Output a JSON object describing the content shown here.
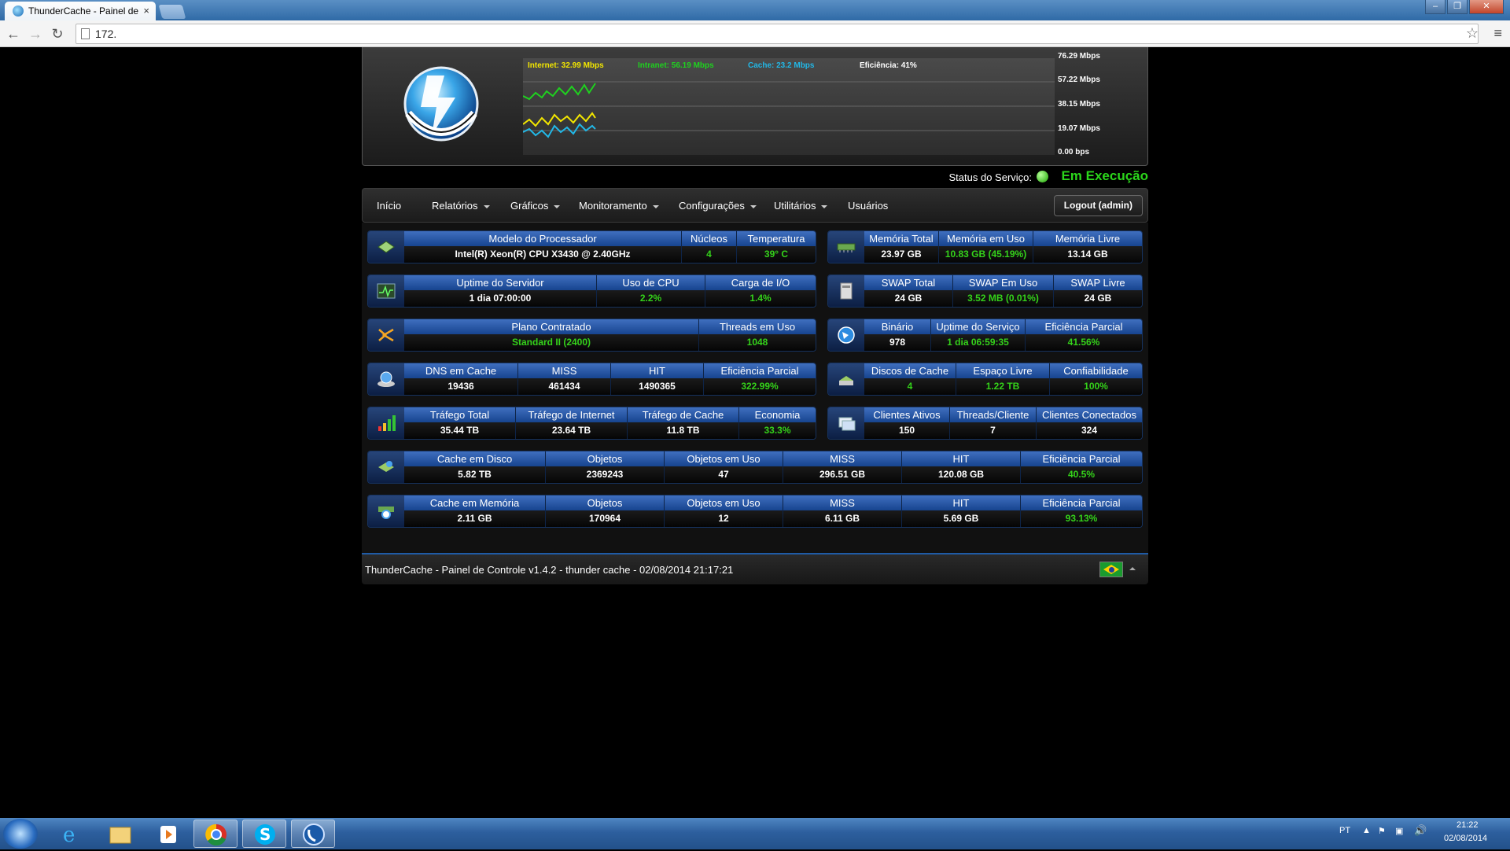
{
  "browser": {
    "tab_title": "ThunderCache - Painel de",
    "tab_close": "×",
    "address": "172."
  },
  "header": {
    "graph": {
      "legend_internet": "Internet: 32.99 Mbps",
      "legend_intranet": "Intranet: 56.19 Mbps",
      "legend_cache": "Cache: 23.2 Mbps",
      "legend_efficiency": "Eficiência: 41%",
      "scale": [
        "76.29 Mbps",
        "57.22 Mbps",
        "38.15 Mbps",
        "19.07 Mbps",
        "0.00 bps"
      ],
      "colors": {
        "internet": "#f2e600",
        "intranet": "#1fd11f",
        "cache": "#22b7e6",
        "efficiency": "#ffffff"
      }
    },
    "status_label": "Status do Serviço:",
    "status_value": "Em Execução"
  },
  "nav": {
    "items": [
      "Início",
      "Relatórios",
      "Gráficos",
      "Monitoramento",
      "Configurações",
      "Utilitários",
      "Usuários"
    ],
    "logout": "Logout (admin)"
  },
  "cards": {
    "cpu": {
      "icon": "chip-icon",
      "h": [
        "Modelo do Processador",
        "Núcleos",
        "Temperatura"
      ],
      "v": [
        "Intel(R) Xeon(R) CPU X3430 @ 2.40GHz",
        "4",
        "39° C"
      ]
    },
    "uptime": {
      "icon": "pulse-icon",
      "h": [
        "Uptime do Servidor",
        "Uso de CPU",
        "Carga de I/O"
      ],
      "v": [
        "1 dia 07:00:00",
        "2.2%",
        "1.4%"
      ]
    },
    "plan": {
      "icon": "share-icon",
      "h": [
        "Plano Contratado",
        "Threads em Uso"
      ],
      "v": [
        "Standard II (2400)",
        "1048"
      ]
    },
    "dns": {
      "icon": "globe-disk-icon",
      "h": [
        "DNS em Cache",
        "MISS",
        "HIT",
        "Eficiência Parcial"
      ],
      "v": [
        "19436",
        "461434",
        "1490365",
        "322.99%"
      ]
    },
    "traffic": {
      "icon": "bars-icon",
      "h": [
        "Tráfego Total",
        "Tráfego de Internet",
        "Tráfego de Cache",
        "Economia"
      ],
      "v": [
        "35.44 TB",
        "23.64 TB",
        "11.8 TB",
        "33.3%"
      ]
    },
    "memory": {
      "icon": "ram-icon",
      "h": [
        "Memória Total",
        "Memória em Uso",
        "Memória Livre"
      ],
      "v": [
        "23.97 GB",
        "10.83 GB (45.19%)",
        "13.14 GB"
      ]
    },
    "swap": {
      "icon": "drive-icon",
      "h": [
        "SWAP Total",
        "SWAP Em Uso",
        "SWAP Livre"
      ],
      "v": [
        "24 GB",
        "3.52 MB (0.01%)",
        "24 GB"
      ]
    },
    "binary": {
      "icon": "globe-icon",
      "h": [
        "Binário",
        "Uptime do Serviço",
        "Eficiência Parcial"
      ],
      "v": [
        "978",
        "1 dia 06:59:35",
        "41.56%"
      ]
    },
    "disks": {
      "icon": "hdd-icon",
      "h": [
        "Discos de Cache",
        "Espaço Livre",
        "Confiabilidade"
      ],
      "v": [
        "4",
        "1.22 TB",
        "100%"
      ]
    },
    "clients": {
      "icon": "clients-icon",
      "h": [
        "Clientes Ativos",
        "Threads/Cliente",
        "Clientes Conectados"
      ],
      "v": [
        "150",
        "7",
        "324"
      ]
    },
    "diskcache": {
      "icon": "disk-cache-icon",
      "h": [
        "Cache em Disco",
        "Objetos",
        "Objetos em Uso",
        "MISS",
        "HIT",
        "Eficiência Parcial"
      ],
      "v": [
        "5.82 TB",
        "2369243",
        "47",
        "296.51 GB",
        "120.08 GB",
        "40.5%"
      ]
    },
    "memcache": {
      "icon": "memory-cache-icon",
      "h": [
        "Cache em Memória",
        "Objetos",
        "Objetos em Uso",
        "MISS",
        "HIT",
        "Eficiência Parcial"
      ],
      "v": [
        "2.11 GB",
        "170964",
        "12",
        "6.11 GB",
        "5.69 GB",
        "93.13%"
      ]
    }
  },
  "footer": {
    "text": "ThunderCache - Painel de Controle v1.4.2 - thunder cache - 02/08/2014 21:17:21"
  },
  "taskbar": {
    "lang": "PT",
    "time": "21:22",
    "date": "02/08/2014"
  }
}
